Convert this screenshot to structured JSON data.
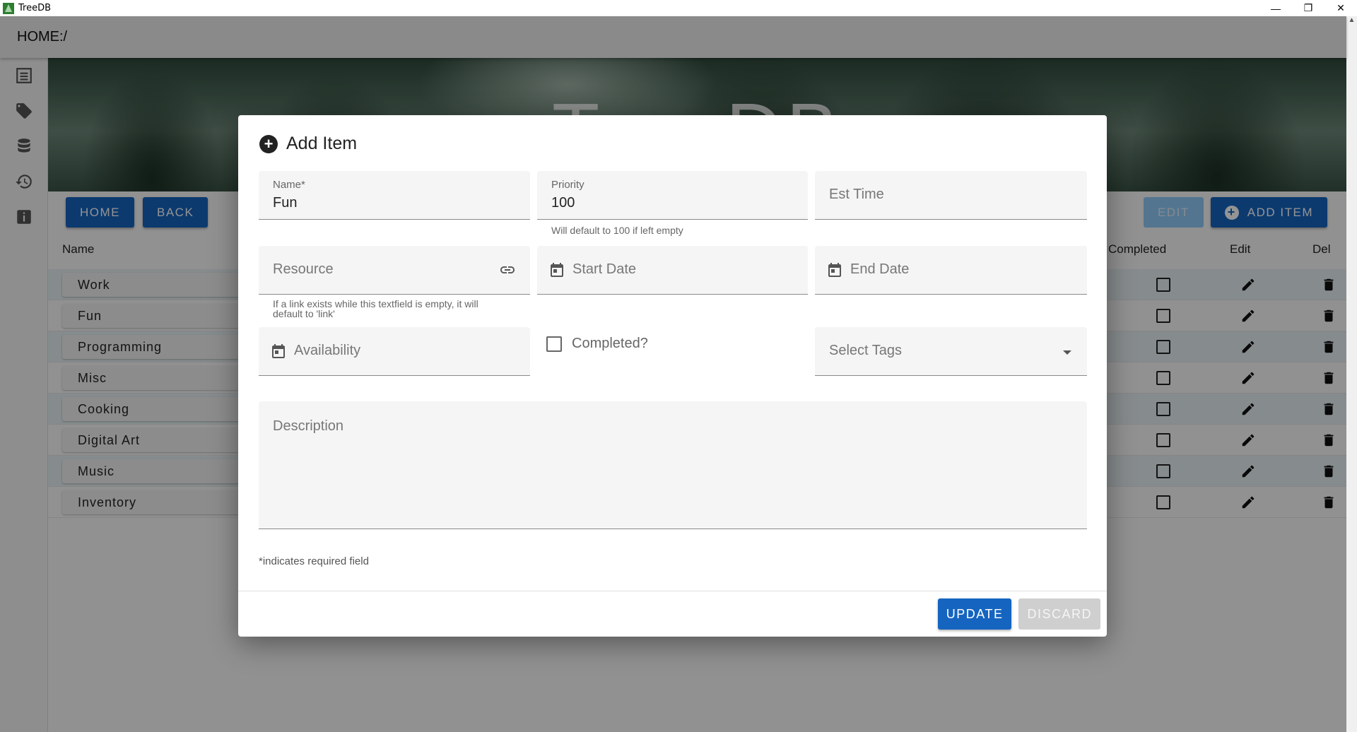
{
  "window": {
    "title": "TreeDB",
    "minimize_glyph": "—",
    "restore_glyph": "❐",
    "close_glyph": "✕"
  },
  "appbar": {
    "path": "HOME:/"
  },
  "sidebar": {
    "icons": [
      "list-icon",
      "tag-icon",
      "database-icon",
      "history-icon",
      "info-icon"
    ]
  },
  "banner": {
    "title": "TreeDB"
  },
  "toolbar": {
    "home_label": "HOME",
    "back_label": "BACK",
    "edit_label": "EDIT",
    "add_item_label": "ADD ITEM"
  },
  "table": {
    "headers": {
      "name": "Name",
      "completed": "Completed",
      "edit": "Edit",
      "del": "Del"
    },
    "rows": [
      "Work",
      "Fun",
      "Programming",
      "Misc",
      "Cooking",
      "Digital Art",
      "Music",
      "Inventory"
    ]
  },
  "dialog": {
    "title": "Add Item",
    "name": {
      "label": "Name*",
      "value": "Fun"
    },
    "priority": {
      "label": "Priority",
      "value": "100",
      "helper": "Will default to 100 if left empty"
    },
    "est_time": {
      "placeholder": "Est Time"
    },
    "resource": {
      "placeholder": "Resource",
      "helper_line1": "If a link exists while this textfield is empty, it will",
      "helper_line2": "default to 'link'"
    },
    "start_date": {
      "placeholder": "Start Date"
    },
    "end_date": {
      "placeholder": "End Date"
    },
    "availability": {
      "placeholder": "Availability"
    },
    "completed": {
      "label": "Completed?",
      "checked": false
    },
    "tags": {
      "placeholder": "Select Tags"
    },
    "description": {
      "placeholder": "Description"
    },
    "required_note": "*indicates required field",
    "update_label": "UPDATE",
    "discard_label": "DISCARD"
  },
  "colors": {
    "primary": "#1565c0",
    "primary_disabled": "#90caf9",
    "overlay": "rgba(0,0,0,0.42)"
  }
}
